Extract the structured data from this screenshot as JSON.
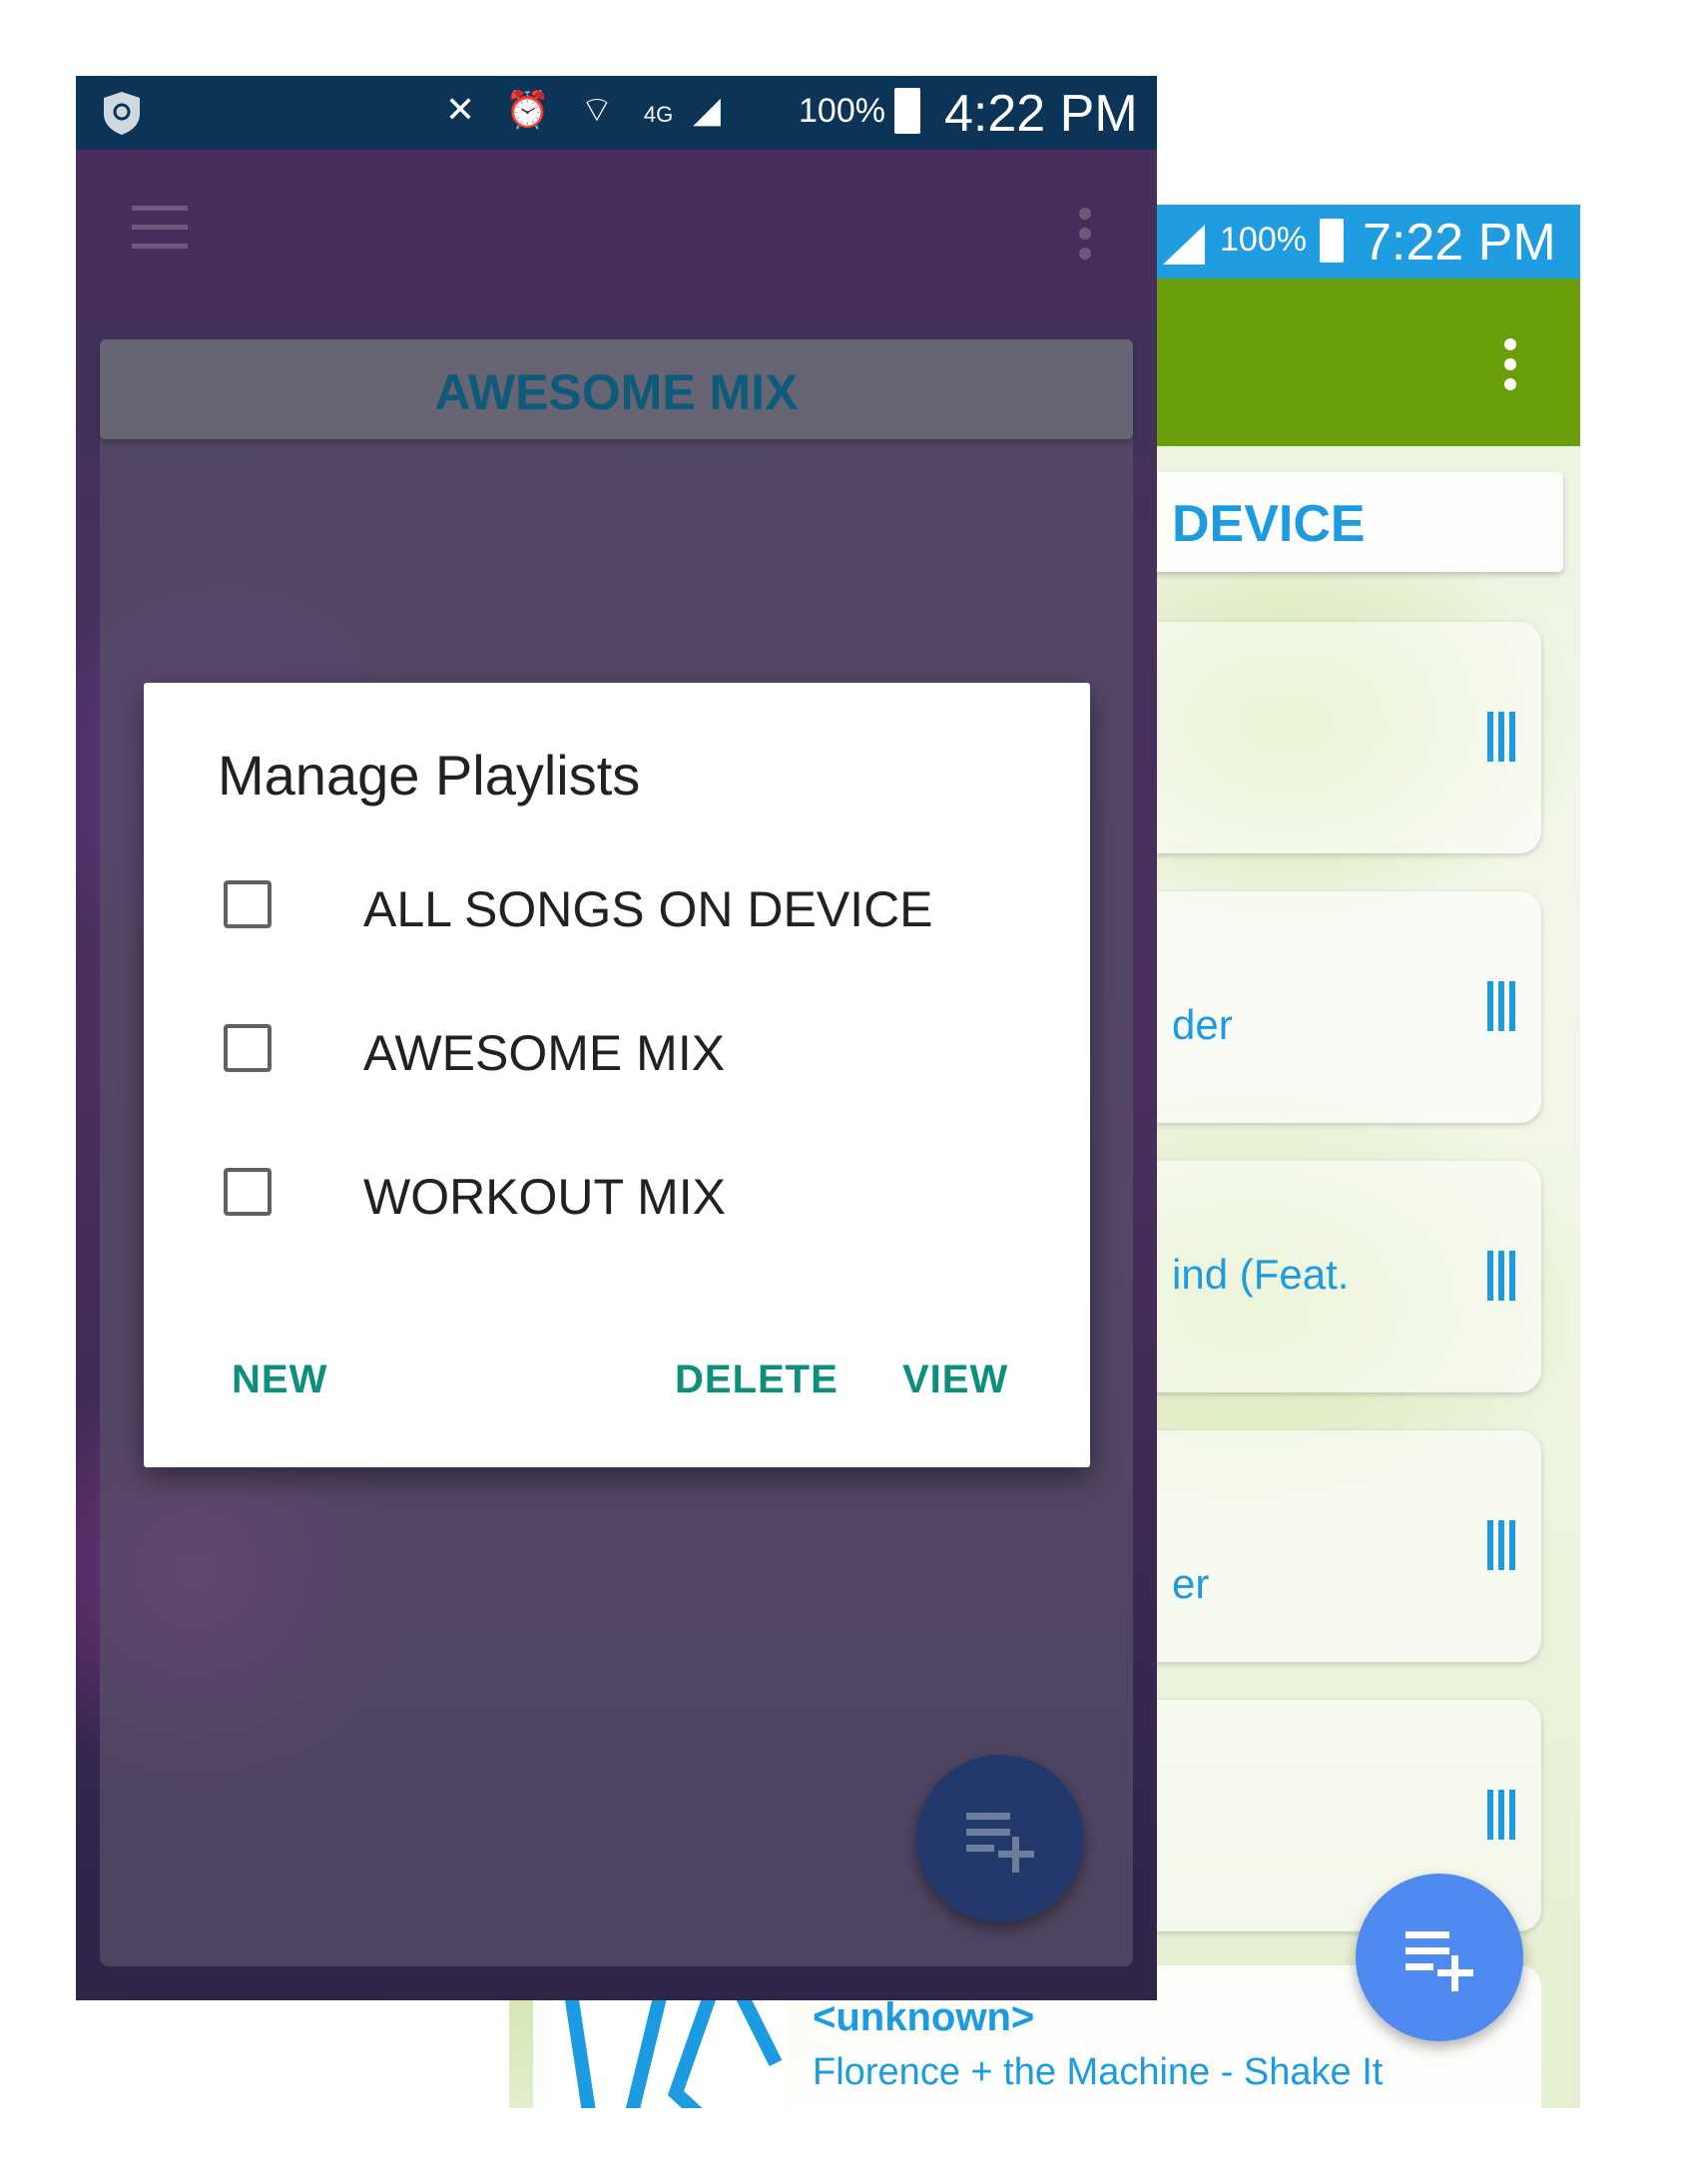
{
  "back_screen": {
    "status": {
      "battery": "100%",
      "time": "7:22 PM"
    },
    "header_partial": "DEVICE",
    "song_fragments": [
      "",
      "der",
      "ind (Feat.",
      "er",
      ""
    ],
    "last_item": {
      "artist": "<unknown>",
      "title": "Florence + the Machine - Shake It"
    },
    "colors": {
      "status_bar": "#1f9de0",
      "toolbar": "#6a9e0b",
      "accent": "#1c9be0",
      "fab": "#4f8af0"
    }
  },
  "front_screen": {
    "status": {
      "battery": "100%",
      "time": "4:22 PM",
      "network": "4G"
    },
    "playlist_title": "AWESOME MIX",
    "colors": {
      "status_bar": "#0b3456",
      "toolbar": "#482e5a",
      "fab": "#23396b"
    }
  },
  "dialog": {
    "title": "Manage Playlists",
    "options": [
      {
        "label": "ALL SONGS ON DEVICE",
        "checked": false
      },
      {
        "label": "AWESOME MIX",
        "checked": false
      },
      {
        "label": "WORKOUT MIX",
        "checked": false
      }
    ],
    "buttons": {
      "new": "NEW",
      "delete": "DELETE",
      "view": "VIEW"
    },
    "accent": "#0d8f7e"
  }
}
